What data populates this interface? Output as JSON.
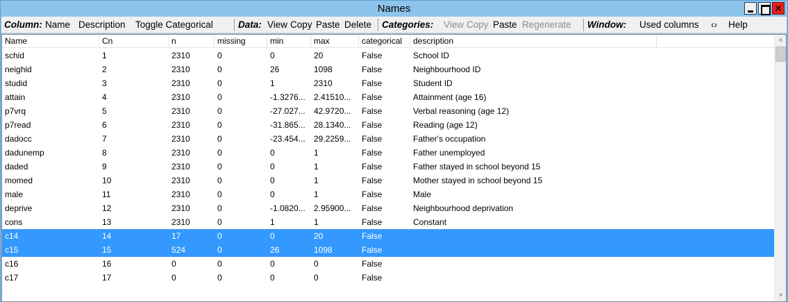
{
  "window": {
    "title": "Names"
  },
  "menubar": {
    "column_group": "Column:",
    "column_items": [
      "Name",
      "Description",
      "Toggle Categorical"
    ],
    "data_group": "Data:",
    "data_items": [
      "View",
      "Copy",
      "Paste",
      "Delete"
    ],
    "categories_group": "Categories:",
    "categories_items": [
      {
        "label": "View",
        "enabled": false
      },
      {
        "label": "Copy",
        "enabled": false
      },
      {
        "label": "Paste",
        "enabled": true
      },
      {
        "label": "Regenerate",
        "enabled": false
      }
    ],
    "window_group": "Window:",
    "window_items": [
      "Used columns",
      "‹›",
      "Help"
    ]
  },
  "table": {
    "columns": [
      "Name",
      "Cn",
      "n",
      "missing",
      "min",
      "max",
      "categorical",
      "description"
    ],
    "rows": [
      {
        "cells": [
          "schid",
          "1",
          "2310",
          "0",
          "0",
          "20",
          "False",
          "School ID"
        ],
        "selected": false
      },
      {
        "cells": [
          "neighid",
          "2",
          "2310",
          "0",
          "26",
          "1098",
          "False",
          "Neighbourhood ID"
        ],
        "selected": false
      },
      {
        "cells": [
          "studid",
          "3",
          "2310",
          "0",
          "1",
          "2310",
          "False",
          "Student ID"
        ],
        "selected": false
      },
      {
        "cells": [
          "attain",
          "4",
          "2310",
          "0",
          "-1.3276...",
          "2.41510...",
          "False",
          "Attainment (age 16)"
        ],
        "selected": false
      },
      {
        "cells": [
          "p7vrq",
          "5",
          "2310",
          "0",
          "-27.027...",
          "42.9720...",
          "False",
          "Verbal reasoning (age 12)"
        ],
        "selected": false
      },
      {
        "cells": [
          "p7read",
          "6",
          "2310",
          "0",
          "-31.865...",
          "28.1340...",
          "False",
          "Reading (age 12)"
        ],
        "selected": false
      },
      {
        "cells": [
          "dadocc",
          "7",
          "2310",
          "0",
          "-23.454...",
          "29.2259...",
          "False",
          "Father's occupation"
        ],
        "selected": false
      },
      {
        "cells": [
          "dadunemp",
          "8",
          "2310",
          "0",
          "0",
          "1",
          "False",
          "Father unemployed"
        ],
        "selected": false
      },
      {
        "cells": [
          "daded",
          "9",
          "2310",
          "0",
          "0",
          "1",
          "False",
          "Father stayed in school beyond 15"
        ],
        "selected": false
      },
      {
        "cells": [
          "momed",
          "10",
          "2310",
          "0",
          "0",
          "1",
          "False",
          "Mother stayed in school beyond 15"
        ],
        "selected": false
      },
      {
        "cells": [
          "male",
          "11",
          "2310",
          "0",
          "0",
          "1",
          "False",
          "Male"
        ],
        "selected": false
      },
      {
        "cells": [
          "deprive",
          "12",
          "2310",
          "0",
          "-1.0820...",
          "2.95900...",
          "False",
          "Neighbourhood deprivation"
        ],
        "selected": false
      },
      {
        "cells": [
          "cons",
          "13",
          "2310",
          "0",
          "1",
          "1",
          "False",
          "Constant"
        ],
        "selected": false
      },
      {
        "cells": [
          "c14",
          "14",
          "17",
          "0",
          "0",
          "20",
          "False",
          ""
        ],
        "selected": true
      },
      {
        "cells": [
          "c15",
          "15",
          "524",
          "0",
          "26",
          "1098",
          "False",
          ""
        ],
        "selected": true
      },
      {
        "cells": [
          "c16",
          "16",
          "0",
          "0",
          "0",
          "0",
          "False",
          ""
        ],
        "selected": false
      },
      {
        "cells": [
          "c17",
          "17",
          "0",
          "0",
          "0",
          "0",
          "False",
          ""
        ],
        "selected": false
      }
    ]
  },
  "scrollbar": {
    "up_arrow": "˄",
    "down_arrow": "˅"
  },
  "colors": {
    "titlebar": "#8cc4ec",
    "selection": "#3399ff",
    "close": "#e2231a"
  }
}
